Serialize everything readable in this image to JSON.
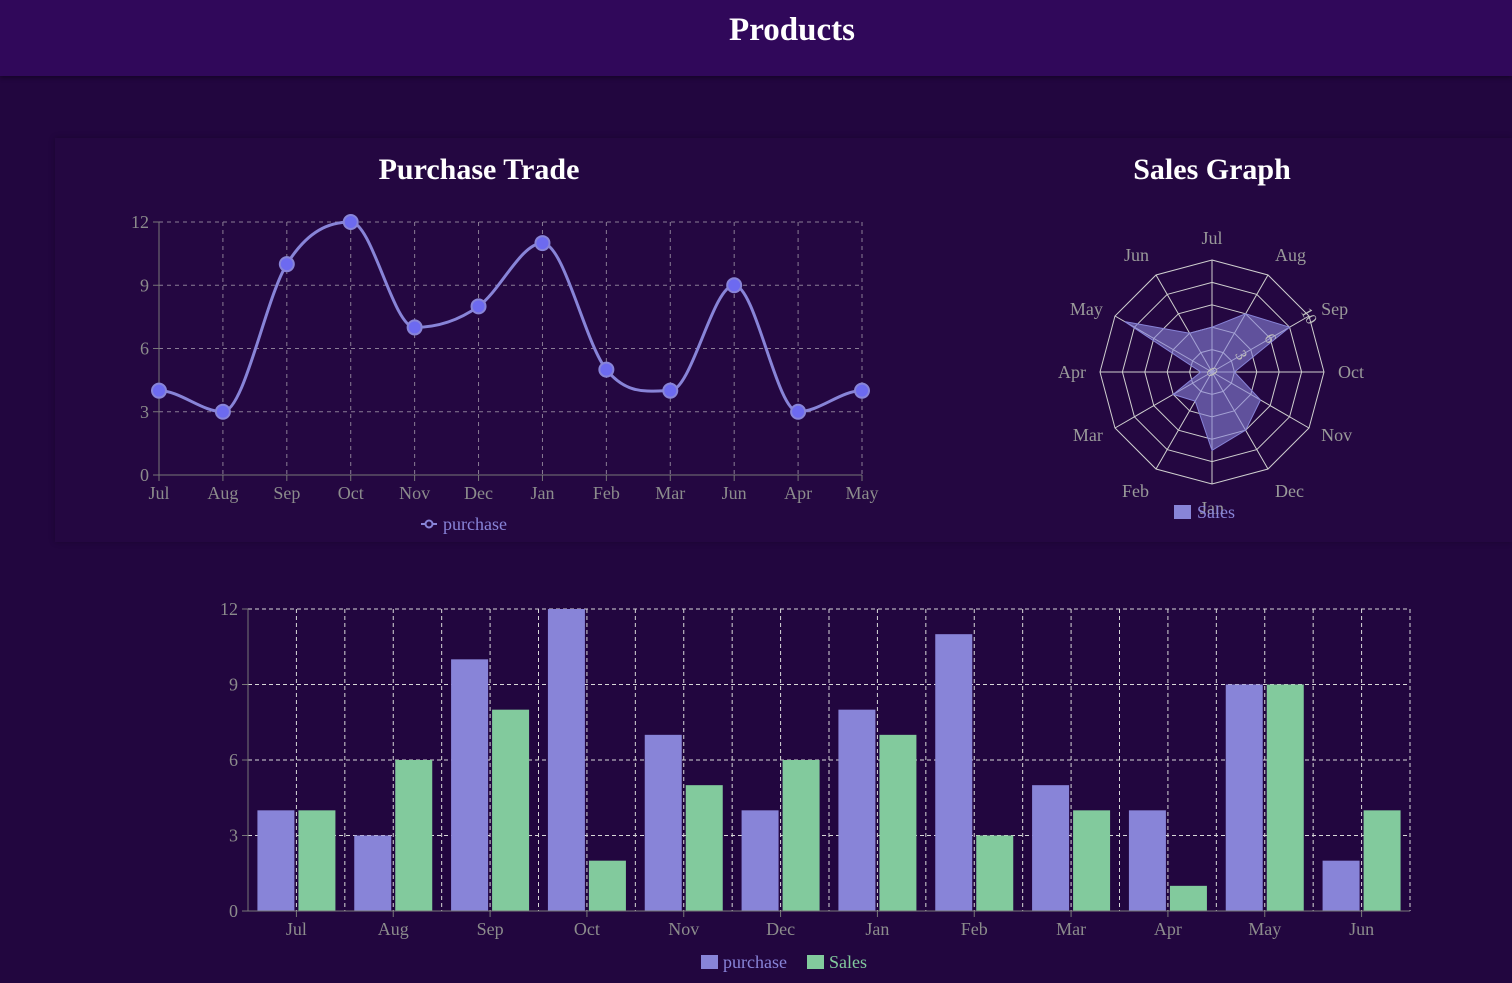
{
  "page": {
    "title": "Products"
  },
  "colors": {
    "background": "#22063f",
    "header": "#30085a",
    "purchase": "#8884d8",
    "purchase_dot": "#6d6af0",
    "sales": "#82ca9d",
    "grid": "#8a7d95",
    "axis_text": "#8c8c8c"
  },
  "chart_data": [
    {
      "id": "purchase-trade",
      "type": "line",
      "title": "Purchase Trade",
      "categories": [
        "Jul",
        "Aug",
        "Sep",
        "Oct",
        "Nov",
        "Dec",
        "Jan",
        "Feb",
        "Mar",
        "Jun",
        "Apr",
        "May"
      ],
      "series": [
        {
          "name": "purchase",
          "values": [
            4,
            3,
            10,
            12,
            7,
            8,
            11,
            5,
            4,
            9,
            3,
            4
          ]
        }
      ],
      "yticks": [
        0,
        3,
        6,
        9,
        12
      ],
      "ylim": [
        0,
        12
      ],
      "grid": true,
      "legend": "bottom-center"
    },
    {
      "id": "sales-graph",
      "type": "radar",
      "title": "Sales Graph",
      "categories": [
        "Jul",
        "Aug",
        "Sep",
        "Oct",
        "Nov",
        "Dec",
        "Jan",
        "Feb",
        "Mar",
        "Apr",
        "May",
        "Jun"
      ],
      "series": [
        {
          "name": "Sales",
          "values": [
            4,
            6,
            8,
            2,
            5,
            6,
            7,
            3,
            4,
            1,
            9,
            4
          ]
        }
      ],
      "radial_ticks": [
        0,
        3,
        6,
        10
      ],
      "rlim": [
        0,
        10
      ],
      "legend": "bottom-center"
    },
    {
      "id": "purchase-sales-bars",
      "type": "bar",
      "title": "",
      "categories": [
        "Jul",
        "Aug",
        "Sep",
        "Oct",
        "Nov",
        "Dec",
        "Jan",
        "Feb",
        "Mar",
        "Apr",
        "May",
        "Jun"
      ],
      "series": [
        {
          "name": "purchase",
          "values": [
            4,
            3,
            10,
            12,
            7,
            4,
            8,
            11,
            5,
            4,
            9,
            2
          ]
        },
        {
          "name": "Sales",
          "values": [
            4,
            6,
            8,
            2,
            5,
            6,
            7,
            3,
            4,
            1,
            9,
            4
          ]
        }
      ],
      "yticks": [
        0,
        3,
        6,
        9,
        12
      ],
      "ylim": [
        0,
        12
      ],
      "grid": true,
      "legend": "bottom-center"
    }
  ]
}
